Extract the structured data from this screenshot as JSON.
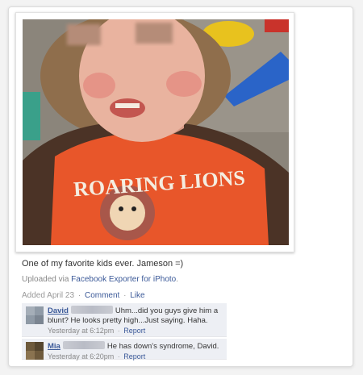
{
  "post": {
    "caption": "One of my favorite kids ever. Jameson =)",
    "uploaded_prefix": "Uploaded via ",
    "uploaded_app": "Facebook Exporter for iPhoto",
    "uploaded_suffix": ".",
    "added": "Added April 23",
    "comment_link": "Comment",
    "like_link": "Like",
    "separator": "·"
  },
  "photo": {
    "shirt_text": "ROARING LIONS",
    "colors": {
      "shirt_orange": "#e8562a",
      "sleeve_brown": "#4b3326",
      "slide_blue": "#2a64c8",
      "toy_yellow": "#e8c21e",
      "skin": "#e9b39f",
      "hair": "#8f6e4c"
    }
  },
  "comments": [
    {
      "author": "David",
      "text": "Uhm...did you guys give him a blunt? He looks pretty high...Just saying. Haha.",
      "time": "Yesterday at 6:12pm",
      "report": "Report",
      "separator": "·",
      "avatar_color": "#8f9aa6"
    },
    {
      "author": "Mia",
      "text": "He has down's syndrome, David.",
      "time": "Yesterday at 6:20pm",
      "report": "Report",
      "separator": "·",
      "avatar_color": "#6e5a3c"
    }
  ]
}
